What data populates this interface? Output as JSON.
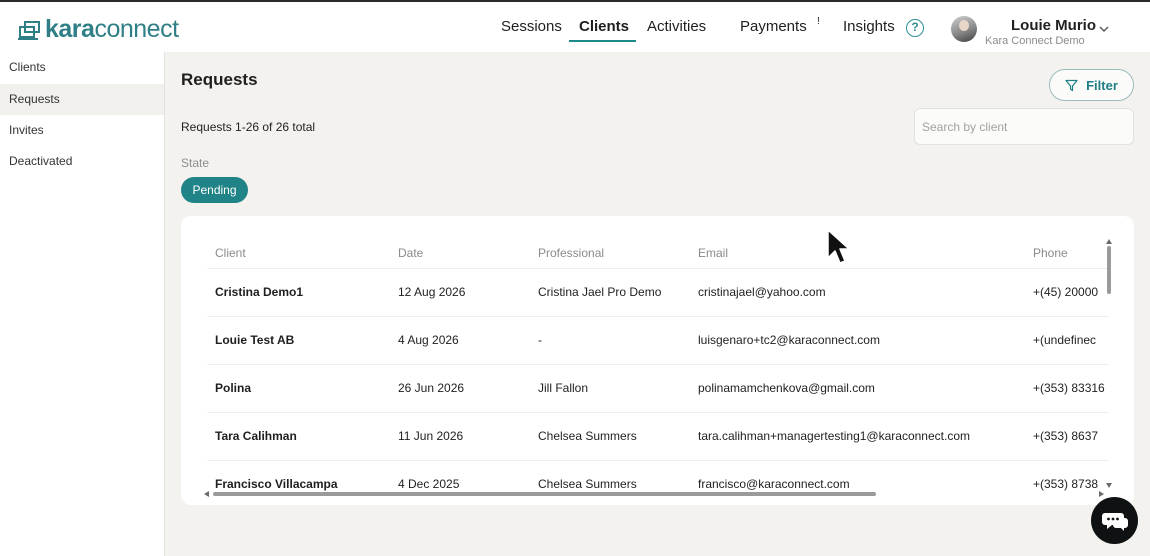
{
  "brand": {
    "name_prefix": "kara",
    "name_suffix": "connect",
    "color": "#2f7f86"
  },
  "nav": {
    "items": [
      {
        "label": "Sessions",
        "active": false
      },
      {
        "label": "Clients",
        "active": true
      },
      {
        "label": "Activities",
        "active": false
      },
      {
        "label": "Payments",
        "active": false
      },
      {
        "label": "Insights",
        "active": false
      }
    ],
    "payments_badge": "!",
    "help_icon": "?"
  },
  "user": {
    "name": "Louie Murio",
    "organization": "Kara Connect Demo",
    "avatar": "avatar-photo"
  },
  "sidebar": {
    "items": [
      {
        "label": "Clients",
        "active": false
      },
      {
        "label": "Requests",
        "active": true
      },
      {
        "label": "Invites",
        "active": false
      },
      {
        "label": "Deactivated",
        "active": false
      }
    ]
  },
  "main": {
    "title": "Requests",
    "filter_label": "Filter",
    "count_text": "Requests 1-26 of 26 total",
    "search_placeholder": "Search by client",
    "state_label": "State",
    "state_chip": "Pending"
  },
  "table": {
    "columns": [
      "Client",
      "Date",
      "Professional",
      "Email",
      "Phone"
    ],
    "rows": [
      [
        "Cristina Demo1",
        "12 Aug 2026",
        "Cristina Jael Pro Demo",
        "cristinajael@yahoo.com",
        "+(45) 20000"
      ],
      [
        "Louie Test AB",
        "4 Aug 2026",
        "-",
        "luisgenaro+tc2@karaconnect.com",
        "+(undefinec"
      ],
      [
        "Polina",
        "26 Jun 2026",
        "Jill Fallon",
        "polinamamchenkova@gmail.com",
        "+(353) 83316"
      ],
      [
        "Tara Calihman",
        "11 Jun 2026",
        "Chelsea Summers",
        "tara.calihman+managertesting1@karaconnect.com",
        "+(353) 8637"
      ],
      [
        "Francisco Villacampa",
        "4 Dec 2025",
        "Chelsea Summers",
        "francisco@karaconnect.com",
        "+(353) 8738"
      ]
    ]
  },
  "colors": {
    "accent": "#1f8388",
    "background": "#f3f2ef",
    "chat_button": "#0f1212"
  },
  "icons": {
    "filter": "filter-funnel-icon",
    "chat": "chat-bubble-icon",
    "cursor": "mouse-pointer-icon"
  }
}
